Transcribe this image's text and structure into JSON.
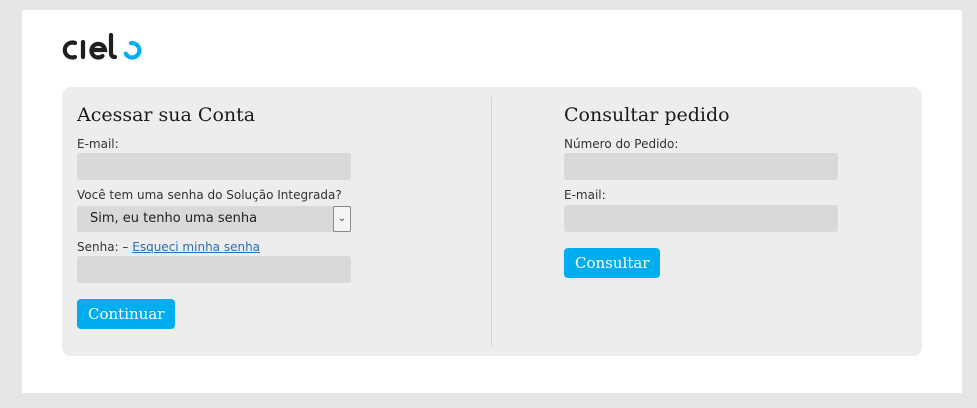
{
  "brand": {
    "logo_text": "cielo"
  },
  "login": {
    "title": "Acessar sua Conta",
    "email_label": "E-mail:",
    "email_value": "",
    "question_label": "Você tem uma senha do Solução Integrada?",
    "select_value": "Sim, eu tenho uma senha",
    "password_label": "Senha: –",
    "forgot_link": "Esqueci minha senha",
    "password_value": "",
    "submit_label": "Continuar"
  },
  "order": {
    "title": "Consultar pedido",
    "order_number_label": "Número do Pedido:",
    "order_number_value": "",
    "email_label": "E-mail:",
    "email_value": "",
    "submit_label": "Consultar"
  },
  "colors": {
    "accent": "#00aeef",
    "panel": "#ededed",
    "input": "#d9d9d9",
    "link": "#2a6ebb"
  }
}
